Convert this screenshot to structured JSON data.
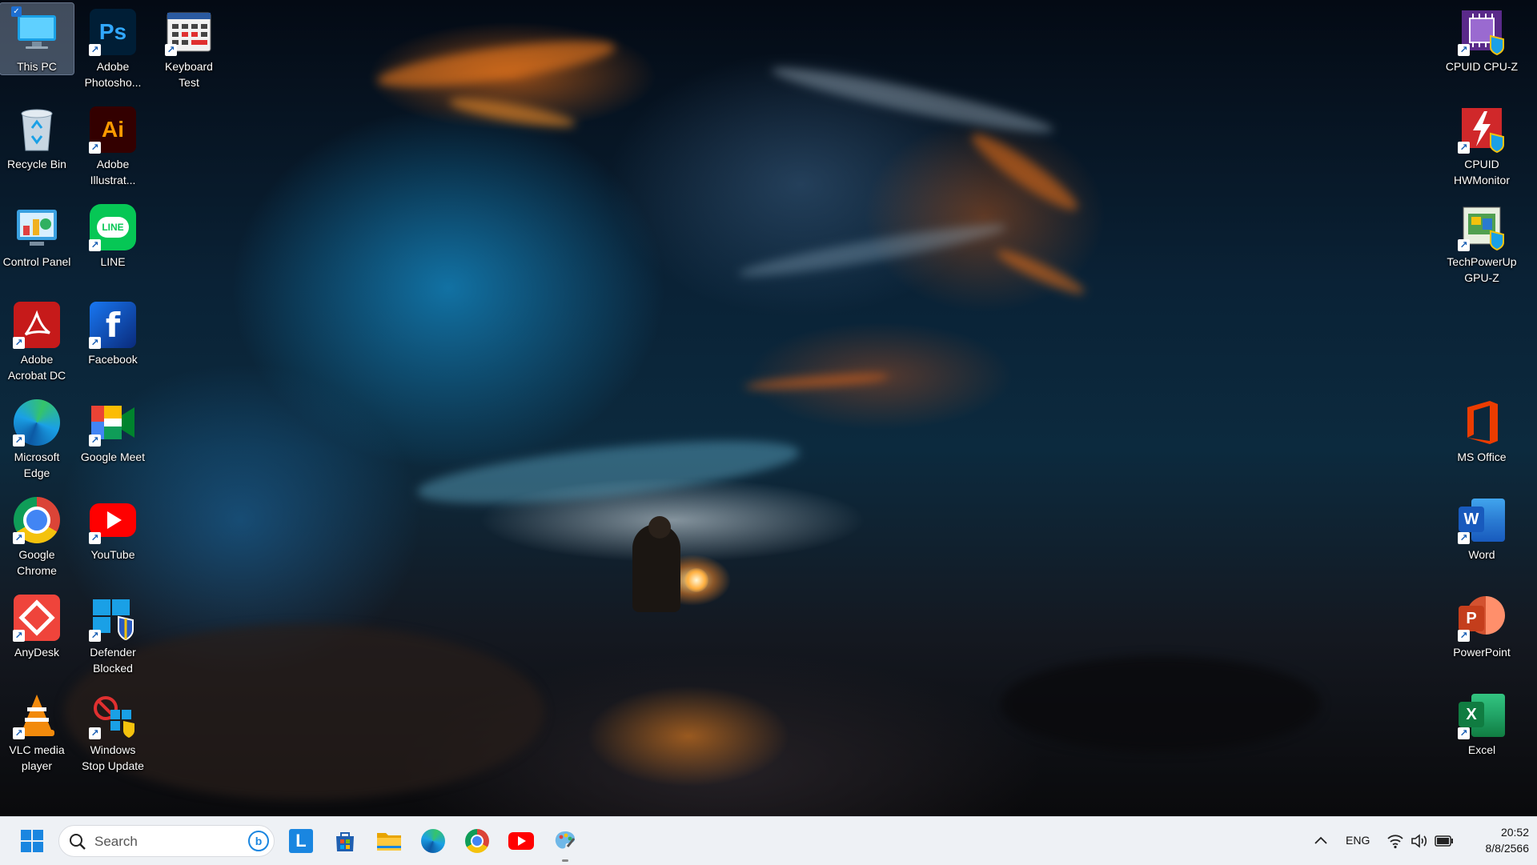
{
  "desktop": {
    "icons_left": [
      {
        "name": "This PC",
        "icon": "this-pc-icon"
      },
      {
        "name": "Recycle Bin",
        "icon": "recycle-bin-icon"
      },
      {
        "name": "Control Panel",
        "icon": "control-panel-icon"
      },
      {
        "name": "Adobe\nAcrobat DC",
        "icon": "adobe-acrobat-icon"
      },
      {
        "name": "Microsoft\nEdge",
        "icon": "edge-icon"
      },
      {
        "name": "Google\nChrome",
        "icon": "chrome-icon"
      },
      {
        "name": "AnyDesk",
        "icon": "anydesk-icon"
      },
      {
        "name": "VLC media\nplayer",
        "icon": "vlc-icon"
      },
      {
        "name": "Adobe\nPhotosho...",
        "icon": "photoshop-icon"
      },
      {
        "name": "Adobe\nIllustrat...",
        "icon": "illustrator-icon"
      },
      {
        "name": "LINE",
        "icon": "line-icon"
      },
      {
        "name": "Facebook",
        "icon": "facebook-icon"
      },
      {
        "name": "Google Meet",
        "icon": "google-meet-icon"
      },
      {
        "name": "YouTube",
        "icon": "youtube-icon"
      },
      {
        "name": "Defender\nBlocked",
        "icon": "defender-icon"
      },
      {
        "name": "Windows\nStop Update",
        "icon": "windows-stop-update-icon"
      },
      {
        "name": "Keyboard\nTest",
        "icon": "keyboard-test-icon"
      }
    ],
    "icons_right": [
      {
        "name": "CPUID CPU-Z",
        "icon": "cpu-z-icon"
      },
      {
        "name": "CPUID\nHWMonitor",
        "icon": "hwmonitor-icon"
      },
      {
        "name": "TechPowerUp\nGPU-Z",
        "icon": "gpu-z-icon"
      },
      {
        "name": "MS Office",
        "icon": "ms-office-icon"
      },
      {
        "name": "Word",
        "icon": "word-icon"
      },
      {
        "name": "PowerPoint",
        "icon": "powerpoint-icon"
      },
      {
        "name": "Excel",
        "icon": "excel-icon"
      }
    ],
    "text": {
      "ps": "Ps",
      "ai": "Ai",
      "line": "LINE",
      "fb": "f",
      "w": "W",
      "p": "P",
      "x": "X"
    }
  },
  "taskbar": {
    "search_placeholder": "Search",
    "pinned": [
      "start-icon",
      "line-app-icon",
      "microsoft-store-icon",
      "file-explorer-icon",
      "edge-icon",
      "chrome-icon",
      "youtube-icon",
      "paint-icon"
    ],
    "line_letter": "L",
    "tray": {
      "language": "ENG",
      "time": "20:52",
      "date": "8/8/2566"
    }
  },
  "colors": {
    "accent": "#1f6fd1",
    "taskbar_bg": "#eef1f5"
  }
}
